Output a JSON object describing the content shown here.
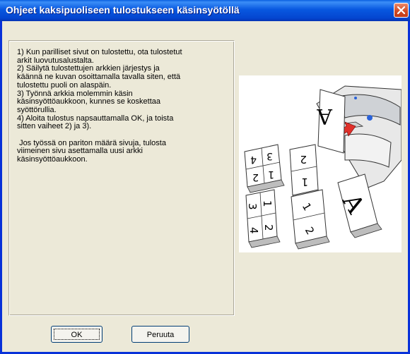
{
  "window": {
    "title": "Ohjeet kaksipuoliseen tulostukseen käsinsyötöllä"
  },
  "instructions": {
    "text": "1) Kun parilliset sivut on tulostettu, ota tulostetut\narkit luovutusalustalta.\n2) Säilytä tulostettujen arkkien järjestys ja\nkäännä ne kuvan osoittamalla tavalla siten, että\ntulostettu puoli on alaspäin.\n3) Työnnä arkkia molemmin käsin\nkäsinsyöttöaukkoon, kunnes se koskettaa\nsyöttörullia.\n4) Aloita tulostus napsauttamalla OK, ja toista\nsitten vaiheet 2) ja 3).\n\n Jos työssä on pariton määrä sivuja, tulosta\nviimeinen sivu asettamalla uusi arkki\nkäsinsyöttöaukkoon."
  },
  "illustration": {
    "sheet_labels": [
      "4",
      "3",
      "2",
      "1",
      "2",
      "1",
      "3",
      "4",
      "1",
      "2",
      "A",
      "A"
    ]
  },
  "buttons": {
    "ok": "OK",
    "cancel": "Peruuta"
  },
  "colors": {
    "titlebar": "#0a5fe0",
    "window_bg": "#ece9d8",
    "close_button": "#d14b25"
  }
}
